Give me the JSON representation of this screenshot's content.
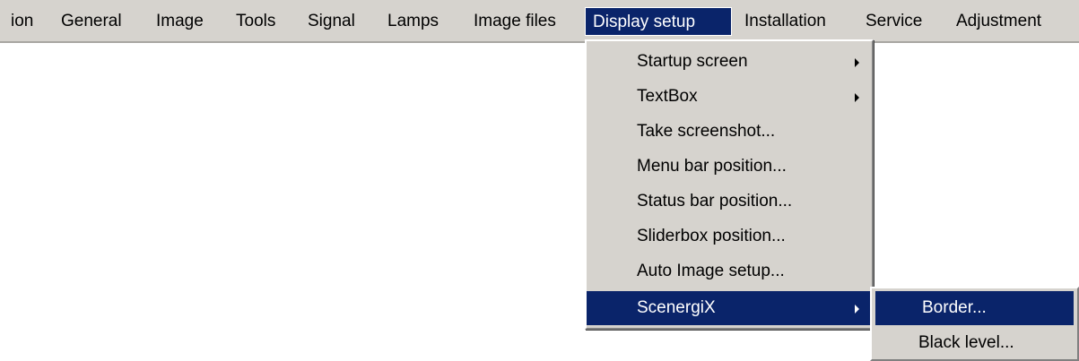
{
  "menubar": {
    "items": [
      {
        "label": "ion"
      },
      {
        "label": "General"
      },
      {
        "label": "Image"
      },
      {
        "label": "Tools"
      },
      {
        "label": "Signal"
      },
      {
        "label": "Lamps"
      },
      {
        "label": "Image files"
      },
      {
        "label": "Display setup"
      },
      {
        "label": "Installation"
      },
      {
        "label": "Service"
      },
      {
        "label": "Adjustment"
      }
    ],
    "active_item": "Display setup"
  },
  "display_setup_menu": {
    "items": [
      {
        "label": "Startup screen",
        "submenu_arrow": true
      },
      {
        "label": "TextBox",
        "submenu_arrow": true
      },
      {
        "label": "Take screenshot..."
      },
      {
        "label": "Menu bar position..."
      },
      {
        "label": "Status bar position..."
      },
      {
        "label": "Sliderbox position..."
      },
      {
        "label": "Auto Image setup..."
      },
      {
        "label": "ScenergiX",
        "submenu_arrow": true,
        "highlighted": true
      }
    ]
  },
  "scenergix_submenu": {
    "items": [
      {
        "label": "Border...",
        "highlighted": true
      },
      {
        "label": "Black level..."
      }
    ]
  },
  "colors": {
    "menu_background": "#d6d3ce",
    "highlight": "#0a246a",
    "highlight_text": "#ffffff"
  }
}
